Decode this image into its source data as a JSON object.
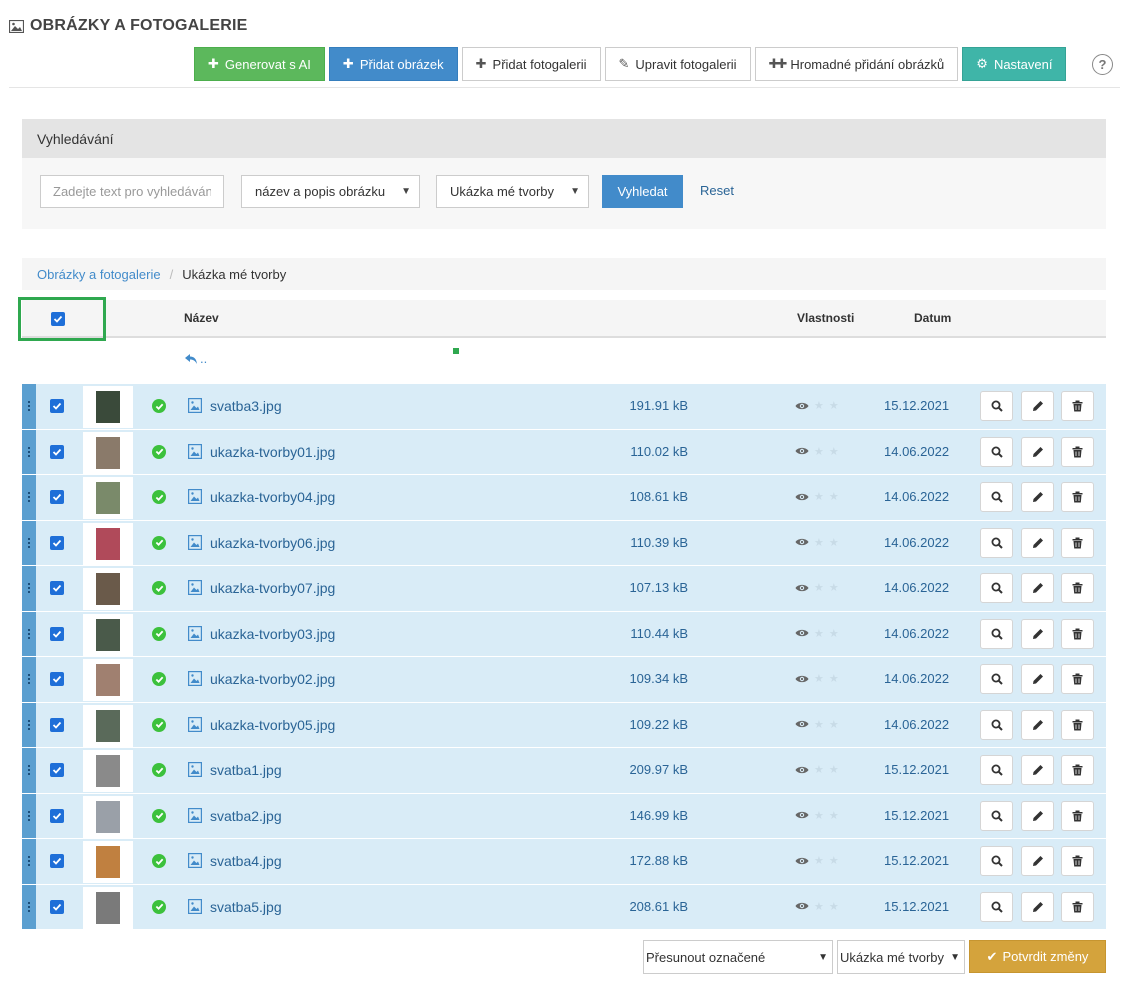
{
  "header": {
    "title": "OBRÁZKY A FOTOGALERIE",
    "icon": "image-icon"
  },
  "toolbar": {
    "generate_ai": "Generovat s AI",
    "add_image": "Přidat obrázek",
    "add_gallery": "Přidat fotogalerii",
    "edit_gallery": "Upravit fotogalerii",
    "bulk_add": "Hromadné přidání obrázků",
    "settings": "Nastavení",
    "help": "?"
  },
  "search": {
    "heading": "Vyhledávání",
    "placeholder": "Zadejte text pro vyhledávání",
    "field_select": "název a popis obrázku",
    "gallery_select": "Ukázka mé tvorby",
    "search_button": "Vyhledat",
    "reset": "Reset"
  },
  "breadcrumb": {
    "root": "Obrázky a fotogalerie",
    "separator": "/",
    "current": "Ukázka mé tvorby"
  },
  "table": {
    "col_name": "Název",
    "col_properties": "Vlastnosti",
    "col_date": "Datum",
    "up_label": "..",
    "header_checked": true,
    "rows": [
      {
        "name": "svatba3.jpg",
        "size": "191.91 kB",
        "date": "15.12.2021",
        "thumb": "#3a4a3a"
      },
      {
        "name": "ukazka-tvorby01.jpg",
        "size": "110.02 kB",
        "date": "14.06.2022",
        "thumb": "#8a7a6a"
      },
      {
        "name": "ukazka-tvorby04.jpg",
        "size": "108.61 kB",
        "date": "14.06.2022",
        "thumb": "#7a8a6a"
      },
      {
        "name": "ukazka-tvorby06.jpg",
        "size": "110.39 kB",
        "date": "14.06.2022",
        "thumb": "#b04a5a"
      },
      {
        "name": "ukazka-tvorby07.jpg",
        "size": "107.13 kB",
        "date": "14.06.2022",
        "thumb": "#6a5a4a"
      },
      {
        "name": "ukazka-tvorby03.jpg",
        "size": "110.44 kB",
        "date": "14.06.2022",
        "thumb": "#4a5a4a"
      },
      {
        "name": "ukazka-tvorby02.jpg",
        "size": "109.34 kB",
        "date": "14.06.2022",
        "thumb": "#a08070"
      },
      {
        "name": "ukazka-tvorby05.jpg",
        "size": "109.22 kB",
        "date": "14.06.2022",
        "thumb": "#5a6a5a"
      },
      {
        "name": "svatba1.jpg",
        "size": "209.97 kB",
        "date": "15.12.2021",
        "thumb": "#8a8a8a"
      },
      {
        "name": "svatba2.jpg",
        "size": "146.99 kB",
        "date": "15.12.2021",
        "thumb": "#9aa0a8"
      },
      {
        "name": "svatba4.jpg",
        "size": "172.88 kB",
        "date": "15.12.2021",
        "thumb": "#c08040"
      },
      {
        "name": "svatba5.jpg",
        "size": "208.61 kB",
        "date": "15.12.2021",
        "thumb": "#7a7a7a"
      }
    ]
  },
  "footer": {
    "move_select": "Přesunout označené",
    "target_select": "Ukázka mé tvorby",
    "confirm": "Potvrdit změny"
  },
  "colors": {
    "accent_blue": "#428bca",
    "green": "#5cb85c",
    "teal": "#3fb5a8",
    "gold": "#d4a33c",
    "row_bg": "#d9ecf7"
  }
}
